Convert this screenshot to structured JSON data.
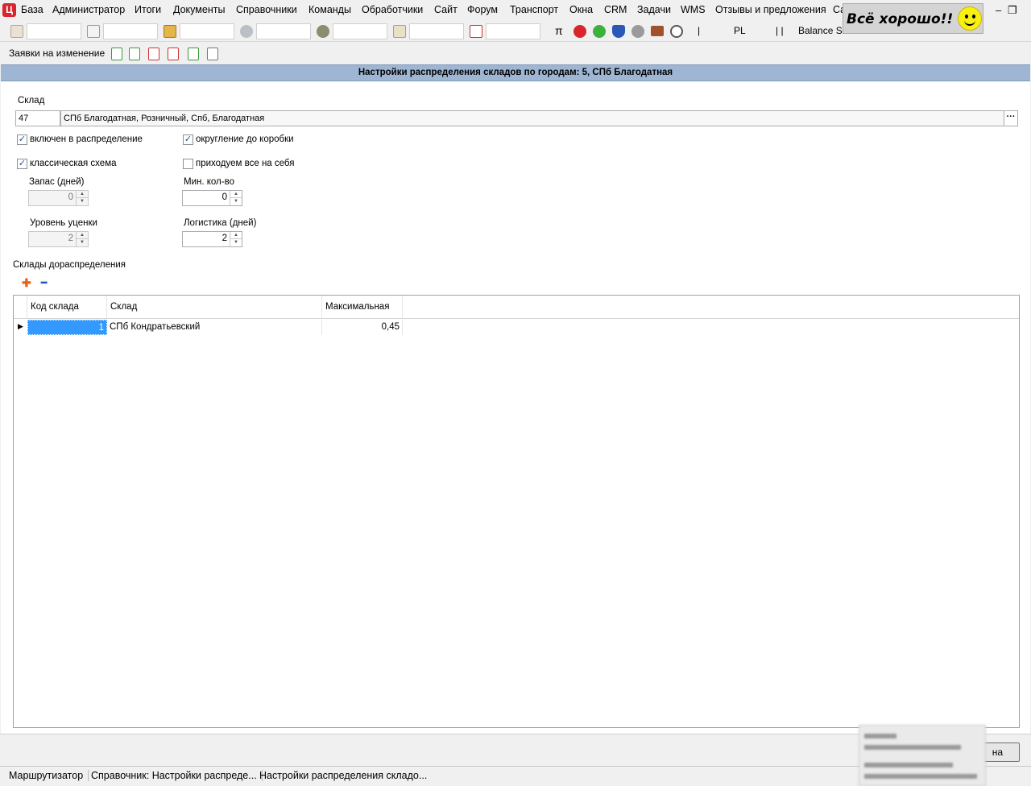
{
  "menu": {
    "items": [
      "База",
      "Администратор",
      "Итоги",
      "Документы",
      "Справочники",
      "Команды",
      "Обработчики",
      "Сайт",
      "Форум",
      "Транспорт",
      "Окна",
      "CRM",
      "Задачи",
      "WMS",
      "Отзывы и предложения",
      "Са"
    ],
    "minimize_glyph": "–",
    "restore_glyph": "❐"
  },
  "status_badge": {
    "text": "Всё хорошо!!"
  },
  "toolbar1": {
    "pi_glyph": "π",
    "separator": "|",
    "pl_label": "PL",
    "double_separator": "| |",
    "balance_label": "Balance Sh"
  },
  "toolbar2": {
    "label": "Заявки на изменение"
  },
  "form": {
    "title": "Настройки распределения складов по городам: 5, СПб Благодатная",
    "warehouse_label": "Склад",
    "warehouse_code": "47",
    "warehouse_name": "СПб Благодатная, Розничный, Спб, Благодатная",
    "browse_glyph": "···",
    "checkboxes": {
      "included": {
        "label": "включен в распределение",
        "checked": true
      },
      "rounding": {
        "label": "округление до коробки",
        "checked": true
      },
      "classic": {
        "label": "классическая схема",
        "checked": true
      },
      "receive_all": {
        "label": "приходуем все на себя",
        "checked": false
      }
    },
    "check_glyph": "✓",
    "stock_days": {
      "label": "Запас (дней)",
      "value": "0"
    },
    "min_qty": {
      "label": "Мин. кол-во",
      "value": "0"
    },
    "markdown_level": {
      "label": "Уровень уценки",
      "value": "2"
    },
    "logistics_days": {
      "label": "Логистика (дней)",
      "value": "2"
    },
    "spin_up": "▲",
    "spin_down": "▼",
    "redistribution_label": "Склады дораспределения",
    "add_glyph": "✚",
    "remove_glyph": "━"
  },
  "grid": {
    "columns": [
      "Код склада",
      "Склад",
      "Максимальная"
    ],
    "row_marker": "▶",
    "rows": [
      {
        "code": "1",
        "warehouse": "СПб Кондратьевский",
        "max": "0,45"
      }
    ]
  },
  "bottom": {
    "button_fragment": "на"
  },
  "taskbar": {
    "tabs": [
      "Маршрутизатор",
      "Справочник: Настройки распреде...",
      "Настройки распределения складо..."
    ]
  },
  "colors": {
    "header_bg": "#9eb6d4",
    "selection": "#3399ff",
    "logo_red": "#d7262e"
  }
}
